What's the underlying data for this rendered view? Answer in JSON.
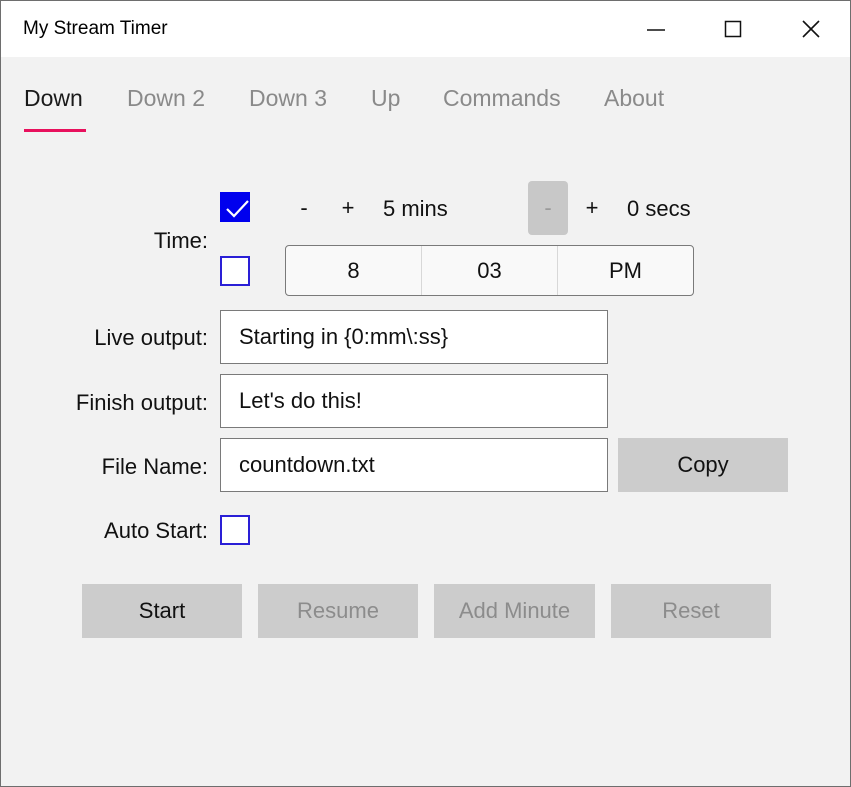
{
  "window": {
    "title": "My Stream Timer"
  },
  "tabs": [
    {
      "label": "Down",
      "active": true
    },
    {
      "label": "Down 2",
      "active": false
    },
    {
      "label": "Down 3",
      "active": false
    },
    {
      "label": "Up",
      "active": false
    },
    {
      "label": "Commands",
      "active": false
    },
    {
      "label": "About",
      "active": false
    }
  ],
  "time": {
    "label": "Time:",
    "duration_checked": true,
    "clock_checked": false,
    "minutes": {
      "minus": "-",
      "plus": "+",
      "value": "5 mins"
    },
    "seconds": {
      "minus": "-",
      "plus": "+",
      "value": "0 secs"
    },
    "clock": {
      "hour": "8",
      "minute": "03",
      "period": "PM"
    }
  },
  "live_output": {
    "label": "Live output:",
    "value": "Starting in {0:mm\\:ss}"
  },
  "finish_output": {
    "label": "Finish output:",
    "value": "Let's do this!"
  },
  "file_name": {
    "label": "File Name:",
    "value": "countdown.txt",
    "copy_label": "Copy"
  },
  "auto_start": {
    "label": "Auto Start:",
    "checked": false
  },
  "actions": {
    "start": "Start",
    "resume": "Resume",
    "add_minute": "Add Minute",
    "reset": "Reset"
  },
  "colors": {
    "accent_underline": "#e8115d",
    "checkbox_blue": "#0000ee",
    "button_gray": "#cccccc",
    "window_bg": "#f2f2f2"
  }
}
